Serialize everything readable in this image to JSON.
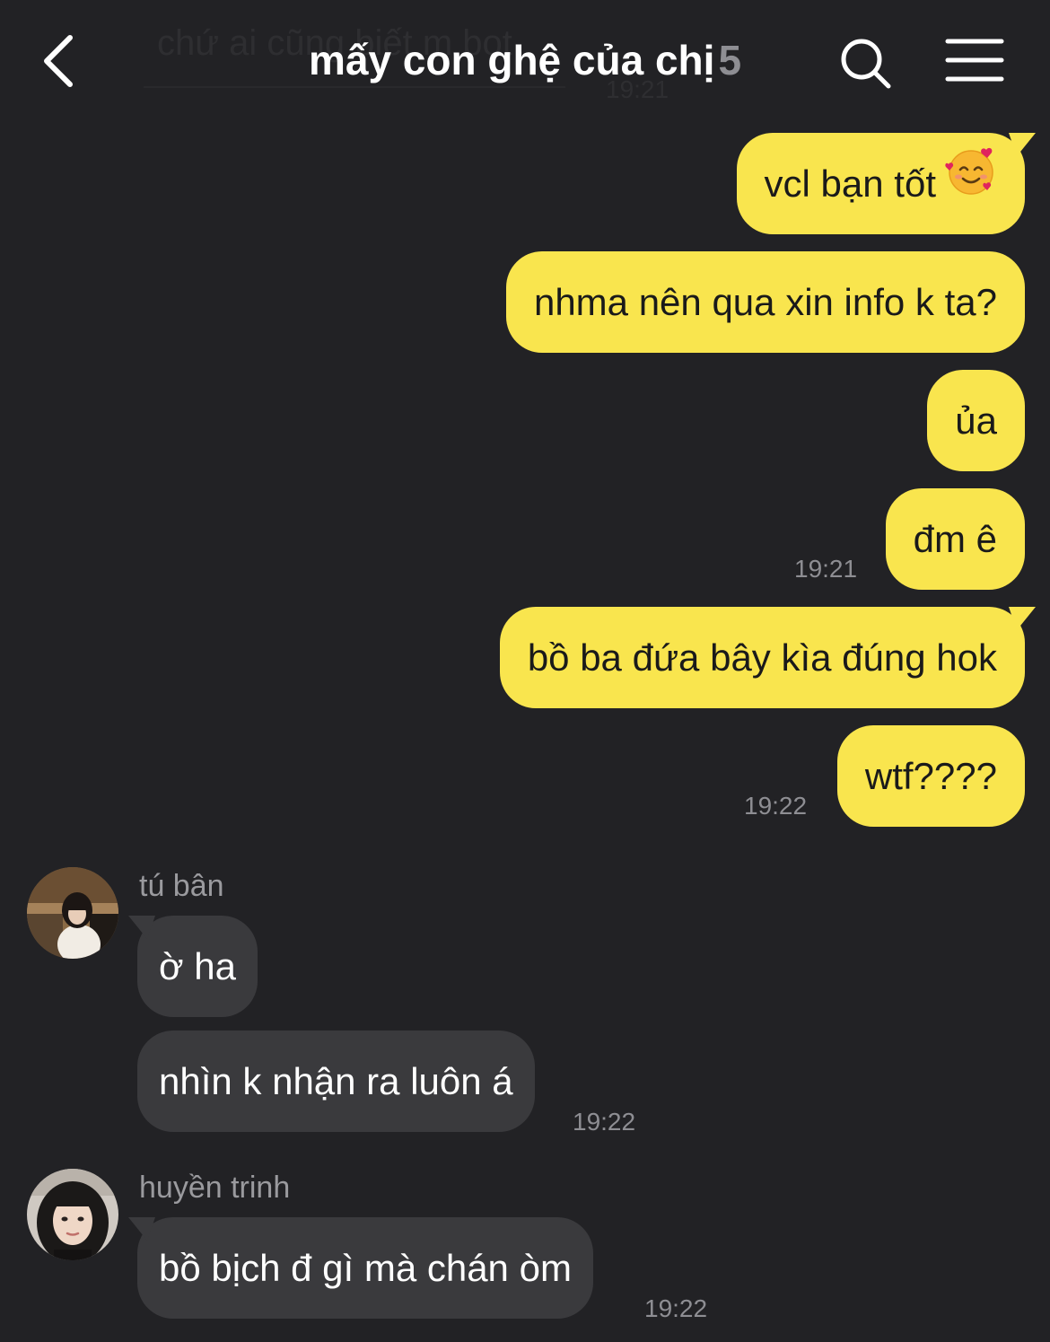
{
  "header": {
    "ghost_message": "chứ ai cũng biết m bot",
    "ghost_time": "19:21",
    "title": "mấy con ghệ của chị",
    "member_count": "5",
    "back_icon": "chevron-left-icon",
    "search_icon": "search-icon",
    "menu_icon": "hamburger-menu-icon"
  },
  "messages_out": [
    {
      "text": "vcl bạn tốt",
      "emoji": "smiling-face-with-hearts"
    },
    {
      "text": "nhma nên qua xin info k ta?"
    },
    {
      "text": "ủa"
    },
    {
      "text": "đm ê",
      "time": "19:21"
    },
    {
      "text": "bồ ba đứa bây kìa đúng hok"
    },
    {
      "text": "wtf????",
      "time": "19:22"
    }
  ],
  "groups_in": [
    {
      "sender": "tú bân",
      "messages": [
        {
          "text": "ờ ha"
        },
        {
          "text": "nhìn k nhận ra luôn á",
          "time": "19:22"
        }
      ]
    },
    {
      "sender": "huyền trinh",
      "messages": [
        {
          "text": "bồ bịch đ gì mà chán òm",
          "time": "19:22"
        }
      ]
    }
  ],
  "colors": {
    "background": "#222225",
    "outgoing_bubble": "#f9e54e",
    "incoming_bubble": "#3a3a3d",
    "timestamp": "#8e8e93"
  }
}
